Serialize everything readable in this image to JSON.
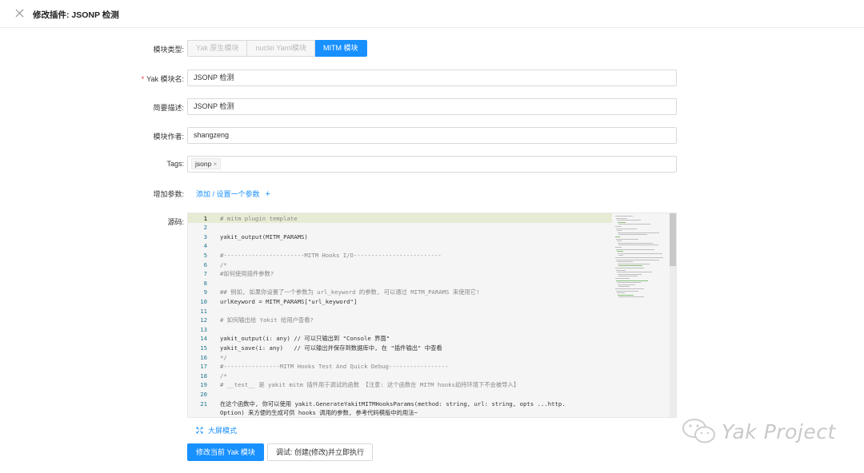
{
  "header": {
    "title": "修改插件: JSONP 检测"
  },
  "form": {
    "module_type": {
      "label": "模块类型",
      "options": [
        "Yak 原生模块",
        "nuclei Yaml模块",
        "MITM 模块"
      ],
      "selected": "MITM 模块"
    },
    "name": {
      "label": "Yak 模块名",
      "required_mark": "*",
      "value": "JSONP 检测"
    },
    "description": {
      "label": "简要描述",
      "value": "JSONP 检测"
    },
    "author": {
      "label": "模块作者",
      "value": "shangzeng"
    },
    "tags": {
      "label": "Tags",
      "items": [
        "jsonp"
      ],
      "remove_glyph": "×"
    },
    "params": {
      "label": "增加参数",
      "add_text": "添加 / 设置一个参数",
      "add_icon": "+"
    },
    "source": {
      "label": "源码",
      "fullscreen_text": "大屏模式"
    }
  },
  "colon": ":",
  "code": {
    "current_line": 1,
    "lines": [
      "# mitm plugin template",
      "",
      "yakit_output(MITM_PARAMS)",
      "",
      "#-----------------------MITM Hooks I/O-------------------------",
      "/*",
      "#如何使用插件参数?",
      "",
      "## 例如, 如果你设置了一个参数为 url_keyword 的参数, 可以通过 MITM_PARAMS 来使用它!",
      "urlKeyword = MITM_PARAMS[\"url_keyword\"]",
      "",
      "# 如何输出给 Yakit 给用户查看?",
      "",
      "yakit_output(i: any) // 可以只输出到 \"Console 界面\"",
      "yakit_save(i: any)   // 可以输出并保存到数据库中, 在 \"插件输出\" 中查看",
      "*/",
      "#----------------MITM Hooks Test And Quick Debug-----------------",
      "/*",
      "# __test__ 是 yakit mitm 插件用于调试的函数 【注意: 这个函数在 MITM hooks劫持环境下不会被导入】",
      "",
      "在这个函数中, 你可以使用 yakit.GenerateYakitMITMHooksParams(method: string, url: string, opts ...http.",
      "Option) 来方便的生成可供 hooks 调用的参数, 参考代码模版中的用法~"
    ],
    "line_numbers": [
      "1",
      "2",
      "3",
      "4",
      "5",
      "6",
      "7",
      "8",
      "9",
      "10",
      "11",
      "12",
      "13",
      "14",
      "15",
      "16",
      "17",
      "18",
      "19",
      "20",
      "21",
      ""
    ]
  },
  "actions": {
    "submit": "修改当前 Yak 模块",
    "debug": "调试: 创建(修改)并立即执行"
  },
  "watermark": "Yak Project",
  "colors": {
    "primary": "#1890ff",
    "required": "#e53935",
    "current_line_bg": "#e6ebd3"
  }
}
